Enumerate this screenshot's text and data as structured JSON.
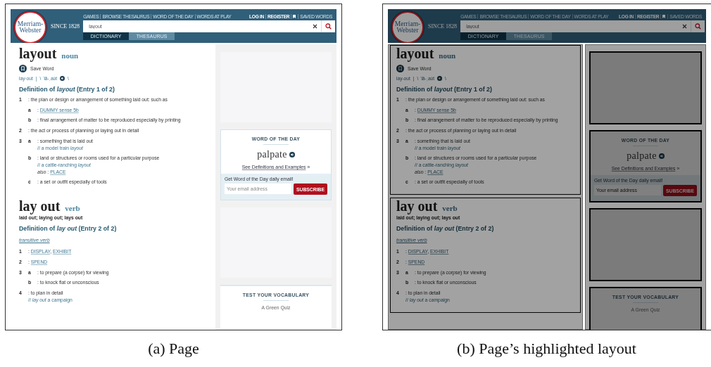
{
  "panels": [
    {
      "caption": "(a) Page",
      "highlighted": false,
      "page": {
        "header": {
          "logo": [
            "Merriam-",
            "Webster"
          ],
          "since": "SINCE 1828",
          "nav": [
            "GAMES",
            "BROWSE THESAURUS",
            "WORD OF THE DAY",
            "WORDS AT PLAY"
          ],
          "account": [
            "LOG IN",
            "REGISTER"
          ],
          "saved": "SAVED WORDS",
          "search": "layout",
          "tabs": [
            {
              "label": "DICTIONARY",
              "selected": true
            },
            {
              "label": "THESAURUS",
              "selected": false
            }
          ]
        },
        "entries": [
          {
            "headword": "layout",
            "pos": "noun",
            "save": "Save Word",
            "pron": {
              "syllables": "lay·out",
              "separator": "|",
              "ipa": "\\ ˈlā-ˌau̇t",
              "end": "\\"
            },
            "heading": "Definition of *layout* (Entry 1 of 2)",
            "senses": [
              {
                "number": "1",
                "parts": [
                  {
                    "text": ": the plan or design or arrangement of something laid out: such as"
                  }
                ],
                "subsenses": [
                  {
                    "letter": "a",
                    "parts": [
                      {
                        "text": ": "
                      },
                      {
                        "link": "DUMMY sense 5b"
                      }
                    ]
                  },
                  {
                    "letter": "b",
                    "parts": [
                      {
                        "text": ": final arrangement of matter to be reproduced especially by printing"
                      }
                    ]
                  }
                ]
              },
              {
                "number": "2",
                "parts": [
                  {
                    "text": ": the act or process of planning or laying out in detail"
                  }
                ]
              },
              {
                "number": "3",
                "subsenses": [
                  {
                    "letter": "a",
                    "parts": [
                      {
                        "text": ": something that is laid out"
                      }
                    ],
                    "example": "// a model train *layout*"
                  },
                  {
                    "letter": "b",
                    "parts": [
                      {
                        "text": ": land or structures or rooms used for a particular purpose"
                      }
                    ],
                    "example": "// a cattle-ranching *layout*",
                    "also": [
                      {
                        "em": "also"
                      },
                      {
                        "text": " : "
                      },
                      {
                        "link": "PLACE"
                      }
                    ]
                  },
                  {
                    "letter": "c",
                    "parts": [
                      {
                        "text": ": a set or outfit especially of tools"
                      }
                    ]
                  }
                ]
              }
            ]
          },
          {
            "headword": "lay out",
            "pos": "verb",
            "forms": "laid out; laying out; lays out",
            "heading": "Definition of *lay out* (Entry 2 of 2)",
            "label": "transitive verb",
            "senses": [
              {
                "number": "1",
                "parts": [
                  {
                    "text": ": "
                  },
                  {
                    "link": "DISPLAY"
                  },
                  {
                    "text": ", "
                  },
                  {
                    "link": "EXHIBIT"
                  }
                ]
              },
              {
                "number": "2",
                "parts": [
                  {
                    "text": ": "
                  },
                  {
                    "link": "SPEND"
                  }
                ]
              },
              {
                "number": "3",
                "subsenses": [
                  {
                    "letter": "a",
                    "parts": [
                      {
                        "text": ": to prepare (a corpse) for viewing"
                      }
                    ]
                  },
                  {
                    "letter": "b",
                    "parts": [
                      {
                        "text": ": to knock flat or unconscious"
                      }
                    ]
                  }
                ]
              },
              {
                "number": "4",
                "parts": [
                  {
                    "text": ": to plan in detail"
                  }
                ],
                "example": "// *lay out* a campaign"
              }
            ]
          }
        ],
        "sidebar": [
          {
            "kind": "ad"
          },
          {
            "kind": "wotd",
            "title": "WORD OF THE DAY",
            "word": "palpate",
            "link": "See Definitions and Examples",
            "more": "»",
            "prompt": "Get Word of the Day daily email!",
            "placeholder": "Your email address",
            "button": "SUBSCRIBE"
          },
          {
            "kind": "ad"
          },
          {
            "kind": "quiz",
            "title": "TEST YOUR VOCABULARY",
            "subtitle": "A Green Quiz"
          }
        ]
      }
    },
    {
      "caption": "(b) Page’s highlighted layout",
      "highlighted": true,
      "page": {
        "header": {
          "logo": [
            "Merriam-",
            "Webster"
          ],
          "since": "SINCE 1828",
          "nav": [
            "GAMES",
            "BROWSE THESAURUS",
            "WORD OF THE DAY",
            "WORDS AT PLAY"
          ],
          "account": [
            "LOG IN",
            "REGISTER"
          ],
          "saved": "SAVED WORDS",
          "search": "layout",
          "tabs": [
            {
              "label": "DICTIONARY",
              "selected": true
            },
            {
              "label": "THESAURUS",
              "selected": false
            }
          ]
        },
        "entries": [
          {
            "headword": "layout",
            "pos": "noun",
            "save": "Save Word",
            "pron": {
              "syllables": "lay-out",
              "separator": "|",
              "ipa": "\\ ˈlā-ˌau̇t",
              "end": "\\"
            },
            "heading": "Definition of *layout* (Entry 1 of 2)",
            "senses": [
              {
                "number": "1",
                "parts": [
                  {
                    "text": ": the plan or design or arrangement of something laid out: such as"
                  }
                ],
                "subsenses": [
                  {
                    "letter": "a",
                    "parts": [
                      {
                        "text": ": "
                      },
                      {
                        "link": "DUMMY sense 5b"
                      }
                    ]
                  },
                  {
                    "letter": "b",
                    "parts": [
                      {
                        "text": ": final arrangement of matter to be reproduced especially by printing"
                      }
                    ]
                  }
                ]
              },
              {
                "number": "2",
                "parts": [
                  {
                    "text": ": the act or process of planning or laying out in detail"
                  }
                ]
              },
              {
                "number": "3",
                "subsenses": [
                  {
                    "letter": "a",
                    "parts": [
                      {
                        "text": ": something that is laid out"
                      }
                    ],
                    "example": "// a model train *layout*"
                  },
                  {
                    "letter": "b",
                    "parts": [
                      {
                        "text": ": land or structures or rooms used for a particular purpose"
                      }
                    ],
                    "example": "// a cattle-ranching *layout*",
                    "also": [
                      {
                        "em": "also"
                      },
                      {
                        "text": " : "
                      },
                      {
                        "link": "PLACE"
                      }
                    ]
                  },
                  {
                    "letter": "c",
                    "parts": [
                      {
                        "text": ": a set or outfit especially of tools"
                      }
                    ]
                  }
                ]
              }
            ]
          },
          {
            "headword": "lay out",
            "pos": "verb",
            "forms": "laid out; laying out; lays out",
            "heading": "Definition of *lay out* (Entry 2 of 2)",
            "label": "transitive verb",
            "senses": [
              {
                "number": "1",
                "parts": [
                  {
                    "text": ": "
                  },
                  {
                    "link": "DISPLAY"
                  },
                  {
                    "text": ", "
                  },
                  {
                    "link": "EXHIBIT"
                  }
                ]
              },
              {
                "number": "2",
                "parts": [
                  {
                    "text": ": "
                  },
                  {
                    "link": "SPEND"
                  }
                ]
              },
              {
                "number": "3",
                "subsenses": [
                  {
                    "letter": "a",
                    "parts": [
                      {
                        "text": ": to prepare (a corpse) for viewing"
                      }
                    ]
                  },
                  {
                    "letter": "b",
                    "parts": [
                      {
                        "text": ": to knock flat or unconscious"
                      }
                    ]
                  }
                ]
              },
              {
                "number": "4",
                "parts": [
                  {
                    "text": ": to plan in detail"
                  }
                ],
                "example": "// *lay out* a campaign"
              }
            ]
          }
        ],
        "sidebar": [
          {
            "kind": "ad"
          },
          {
            "kind": "wotd",
            "title": "WORD OF THE DAY",
            "word": "palpate",
            "link": "See Definitions and Examples",
            "more": "»",
            "prompt": "Get Word of the Day daily email!",
            "placeholder": "Your email address",
            "button": "SUBSCRIBE"
          },
          {
            "kind": "ad"
          },
          {
            "kind": "quiz",
            "title": "TEST YOUR VOCABULARY",
            "subtitle": "A Green Quiz"
          }
        ]
      }
    }
  ]
}
